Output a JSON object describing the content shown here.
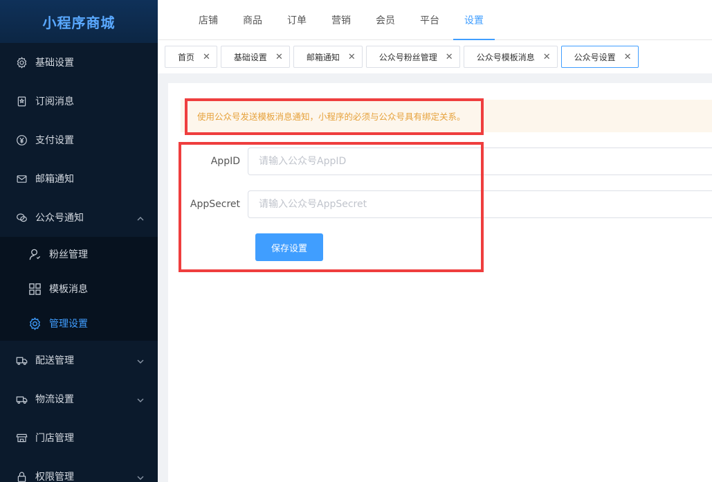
{
  "app": {
    "title": "小程序商城"
  },
  "sidebar": {
    "items": [
      {
        "label": "基础设置",
        "icon": "gear-icon"
      },
      {
        "label": "订阅消息",
        "icon": "bookmark-icon"
      },
      {
        "label": "支付设置",
        "icon": "yuan-icon"
      },
      {
        "label": "邮箱通知",
        "icon": "mail-icon"
      },
      {
        "label": "公众号通知",
        "icon": "wechat-icon",
        "expanded": true
      }
    ],
    "sub_items": [
      {
        "label": "粉丝管理",
        "icon": "user-icon"
      },
      {
        "label": "模板消息",
        "icon": "grid-icon"
      },
      {
        "label": "管理设置",
        "icon": "gear-icon",
        "active": true
      }
    ],
    "items_after": [
      {
        "label": "配送管理",
        "icon": "delivery-icon"
      },
      {
        "label": "物流设置",
        "icon": "truck-icon"
      },
      {
        "label": "门店管理",
        "icon": "store-icon"
      },
      {
        "label": "权限管理",
        "icon": "lock-icon"
      }
    ]
  },
  "topnav": {
    "tabs": [
      "店铺",
      "商品",
      "订单",
      "营销",
      "会员",
      "平台",
      "设置"
    ],
    "active": "设置"
  },
  "tags": [
    "首页",
    "基础设置",
    "邮箱通知",
    "公众号粉丝管理",
    "公众号模板消息",
    "公众号设置"
  ],
  "alert": {
    "text": "使用公众号发送模板消息通知，小程序的必须与公众号具有绑定关系。"
  },
  "form": {
    "appid_label": "AppID",
    "appid_placeholder": "请输入公众号AppID",
    "secret_label": "AppSecret",
    "secret_placeholder": "请输入公众号AppSecret",
    "save_label": "保存设置"
  },
  "colors": {
    "accent": "#409eff",
    "sidebar_bg": "#0b1a2c",
    "alert_text": "#e6a23c",
    "annotation": "#ef3e3e"
  }
}
